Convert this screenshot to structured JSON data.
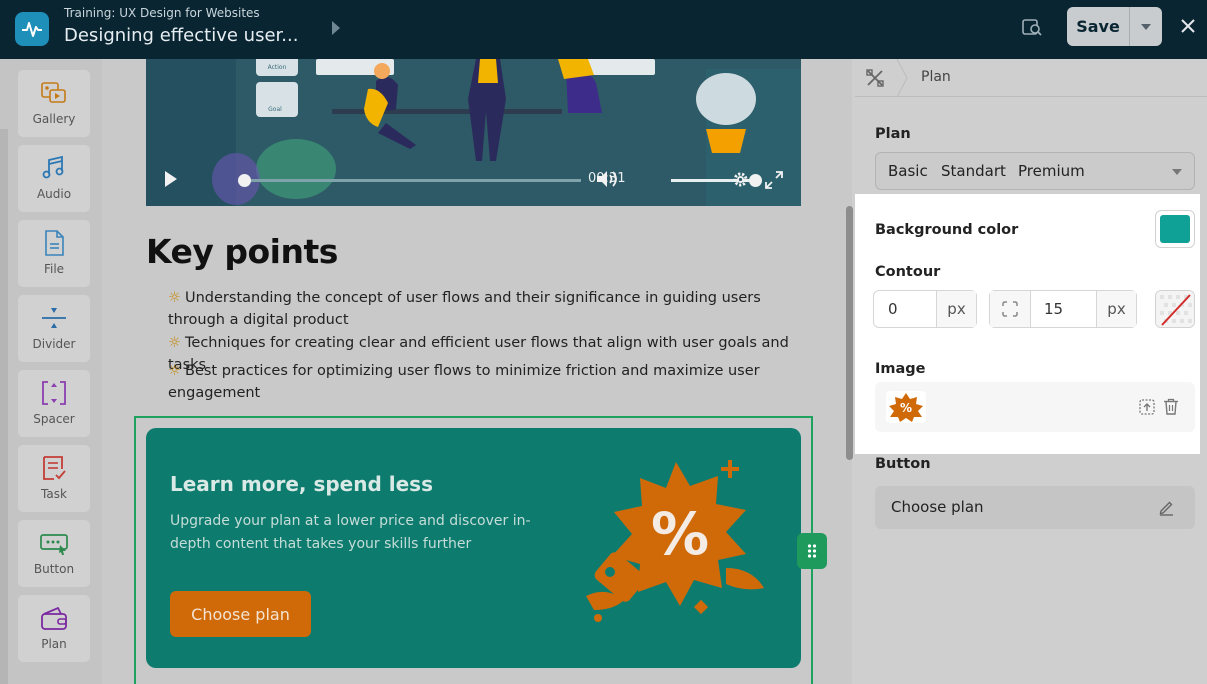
{
  "header": {
    "breadcrumb": "Training: UX Design for Websites",
    "title": "Designing effective user...",
    "save_label": "Save"
  },
  "sidebar": {
    "items": [
      {
        "label": "Gallery",
        "icon": "gallery-icon"
      },
      {
        "label": "Audio",
        "icon": "music-note-icon"
      },
      {
        "label": "File",
        "icon": "file-icon"
      },
      {
        "label": "Divider",
        "icon": "divider-icon"
      },
      {
        "label": "Spacer",
        "icon": "spacer-icon"
      },
      {
        "label": "Task",
        "icon": "task-icon"
      },
      {
        "label": "Button",
        "icon": "button-icon"
      },
      {
        "label": "Plan",
        "icon": "wallet-icon"
      }
    ]
  },
  "video": {
    "time": "00:31",
    "progress": 0.0,
    "volume": 1.0,
    "thumbnail_labels": [
      "Action",
      "Goal"
    ]
  },
  "content": {
    "heading": "Key points",
    "points": [
      "Understanding the concept of user flows and their significance in guiding users through a digital product",
      "Techniques for creating clear and efficient user flows that align with user goals and tasks",
      "Best practices for optimizing user flows to minimize friction and maximize user engagement"
    ],
    "bullet_glyph": "☼"
  },
  "banner": {
    "title": "Learn more, spend less",
    "text": "Upgrade your plan at a lower price and discover in-depth content that takes your skills further",
    "button_label": "Choose plan",
    "background_color": "#0e7b6f",
    "button_color": "#d06a09",
    "art_icon": "discount-badge-icon",
    "art_symbol": "%"
  },
  "panel": {
    "breadcrumb": "Plan",
    "plan_label": "Plan",
    "plan_options": [
      "Basic",
      "Standart",
      "Premium"
    ],
    "background_color_label": "Background color",
    "background_color_value": "#10a196",
    "contour_label": "Contour",
    "contour_width": "0",
    "contour_radius": "15",
    "unit": "px",
    "image_label": "Image",
    "button_label": "Button",
    "button_value": "Choose plan"
  }
}
